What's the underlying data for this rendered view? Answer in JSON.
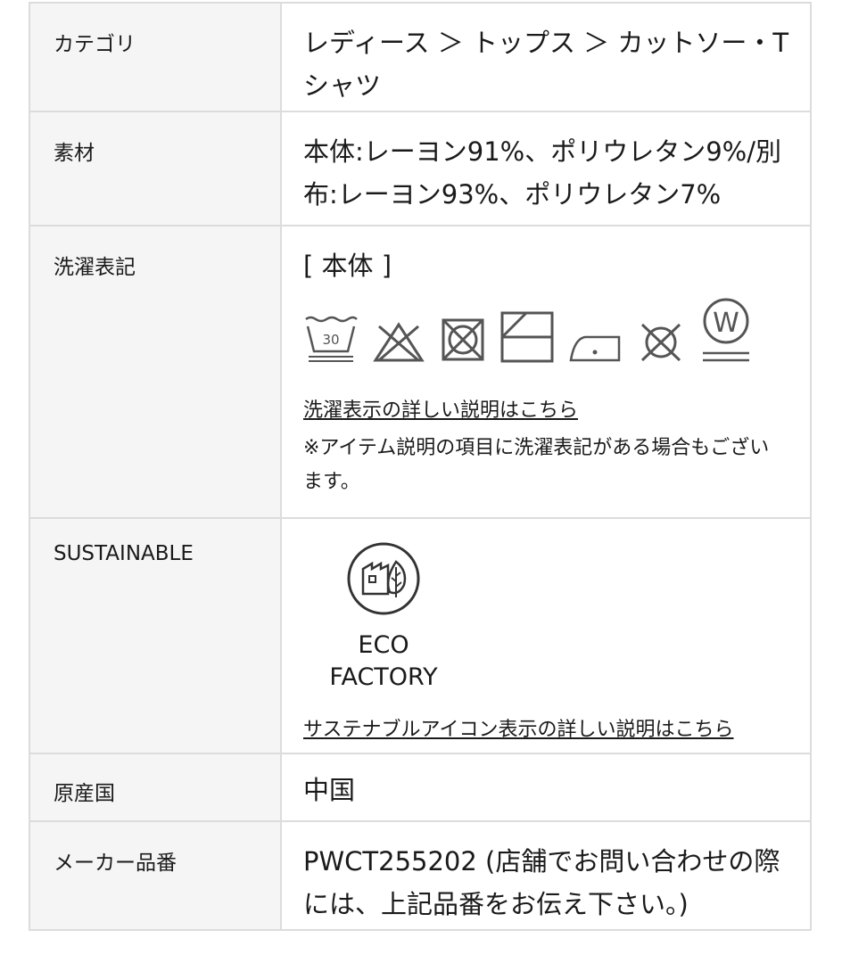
{
  "spec": {
    "category": {
      "label": "カテゴリ",
      "value": "レディース ＞ トップス ＞ カットソー・Tシャツ"
    },
    "material": {
      "label": "素材",
      "value": "本体:レーヨン91%、ポリウレタン9%/別布:レーヨン93%、ポリウレタン7%"
    },
    "care": {
      "label": "洗濯表記",
      "part": "[ 本体 ]",
      "wash_temp": "30",
      "icons": [
        "wash-30-gentle-icon",
        "no-bleach-icon",
        "no-tumble-dry-icon",
        "drip-dry-shade-icon",
        "low-iron-icon",
        "no-dry-clean-icon",
        "wet-clean-icon"
      ],
      "link": "洗濯表示の詳しい説明はこちら",
      "note": "※アイテム説明の項目に洗濯表記がある場合もございます。"
    },
    "sustainable": {
      "label": "SUSTAINABLE",
      "badge_text": "ECO FACTORY",
      "icon": "eco-factory-icon",
      "link": "サステナブルアイコン表示の詳しい説明はこちら"
    },
    "origin": {
      "label": "原産国",
      "value": "中国"
    },
    "maker_code": {
      "label": "メーカー品番",
      "value": "PWCT255202 (店舗でお問い合わせの際には、上記品番をお伝え下さい。)"
    }
  },
  "colors": {
    "label_bg": "#f5f5f5",
    "border": "#dcdcdc",
    "text": "#1a1a1a",
    "icon": "#555555"
  }
}
